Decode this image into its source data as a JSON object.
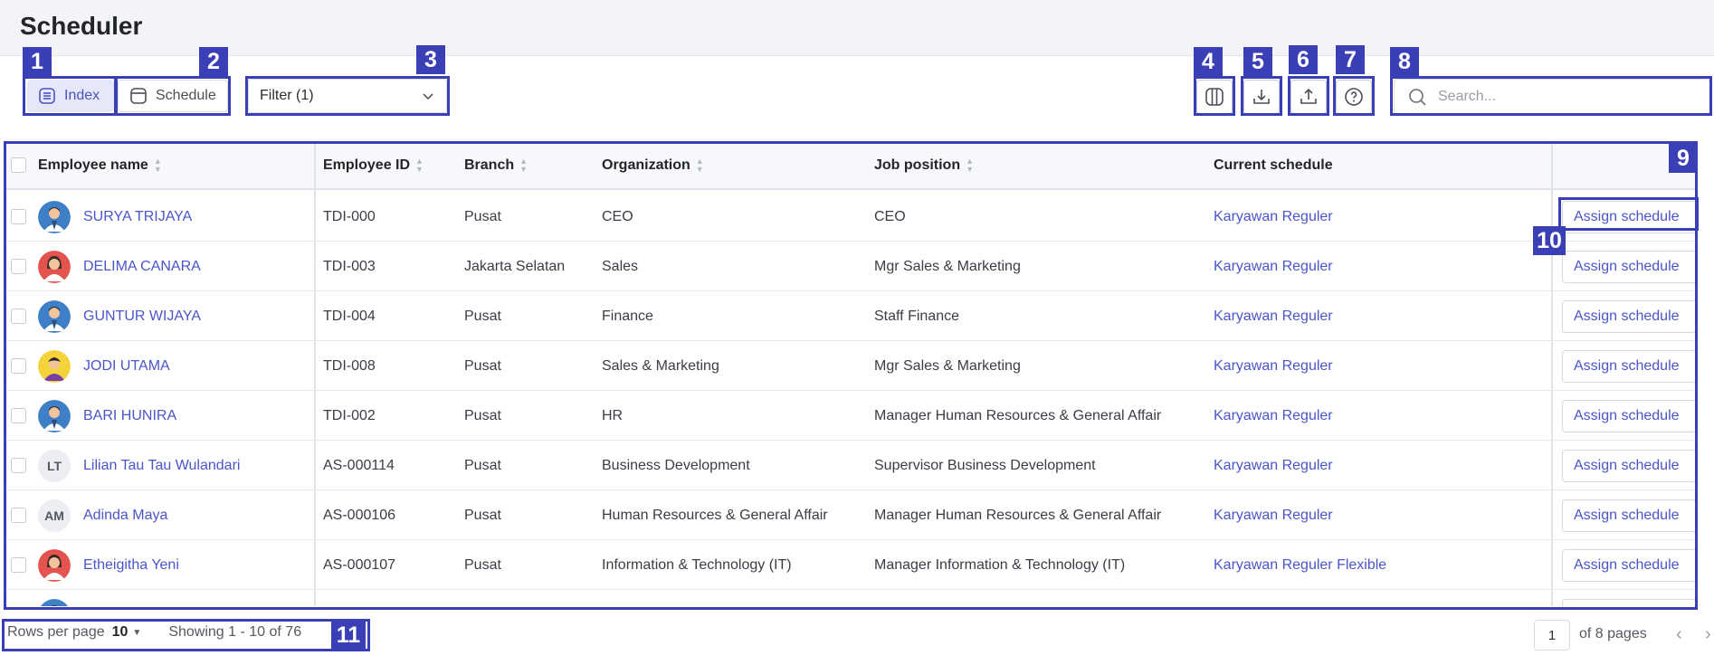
{
  "page": {
    "title": "Scheduler"
  },
  "views": {
    "index_label": "Index",
    "schedule_label": "Schedule"
  },
  "filter": {
    "label": "Filter (1)"
  },
  "toolbar": {
    "columns_icon": "columns-icon",
    "download_icon": "download-icon",
    "export_icon": "export-icon",
    "help_icon": "help-icon"
  },
  "search": {
    "placeholder": "Search..."
  },
  "table": {
    "headers": {
      "employee_name": "Employee name",
      "employee_id": "Employee ID",
      "branch": "Branch",
      "organization": "Organization",
      "job_position": "Job position",
      "current_schedule": "Current schedule"
    },
    "action_label": "Assign schedule",
    "rows": [
      {
        "name": "SURYA TRIJAYA",
        "avatar": "photo-blue",
        "initials": "",
        "id": "TDI-000",
        "branch": "Pusat",
        "organization": "CEO",
        "job": "CEO",
        "schedule": "Karyawan Reguler"
      },
      {
        "name": "DELIMA CANARA",
        "avatar": "photo-red",
        "initials": "",
        "id": "TDI-003",
        "branch": "Jakarta Selatan",
        "organization": "Sales",
        "job": "Mgr Sales & Marketing",
        "schedule": "Karyawan Reguler"
      },
      {
        "name": "GUNTUR WIJAYA",
        "avatar": "photo-blue",
        "initials": "",
        "id": "TDI-004",
        "branch": "Pusat",
        "organization": "Finance",
        "job": "Staff Finance",
        "schedule": "Karyawan Reguler"
      },
      {
        "name": "JODI UTAMA",
        "avatar": "photo-yellow",
        "initials": "",
        "id": "TDI-008",
        "branch": "Pusat",
        "organization": "Sales & Marketing",
        "job": "Mgr Sales & Marketing",
        "schedule": "Karyawan Reguler"
      },
      {
        "name": "BARI HUNIRA",
        "avatar": "photo-blue",
        "initials": "",
        "id": "TDI-002",
        "branch": "Pusat",
        "organization": "HR",
        "job": "Manager Human Resources & General Affair",
        "schedule": "Karyawan Reguler"
      },
      {
        "name": "Lilian Tau Tau Wulandari",
        "avatar": "initials",
        "initials": "LT",
        "id": "AS-000114",
        "branch": "Pusat",
        "organization": "Business Development",
        "job": "Supervisor Business Development",
        "schedule": "Karyawan Reguler"
      },
      {
        "name": "Adinda Maya",
        "avatar": "initials",
        "initials": "AM",
        "id": "AS-000106",
        "branch": "Pusat",
        "organization": "Human Resources & General Affair",
        "job": "Manager Human Resources & General Affair",
        "schedule": "Karyawan Reguler"
      },
      {
        "name": "Etheigitha Yeni",
        "avatar": "photo-red",
        "initials": "",
        "id": "AS-000107",
        "branch": "Pusat",
        "organization": "Information & Technology (IT)",
        "job": "Manager Information & Technology (IT)",
        "schedule": "Karyawan Reguler Flexible"
      }
    ]
  },
  "footer": {
    "rows_per_page_label": "Rows per page",
    "rows_per_page_value": "10",
    "showing": "Showing 1 - 10 of 76",
    "current_page": "1",
    "pages_text": "of 8 pages"
  },
  "annotations": [
    "1",
    "2",
    "3",
    "4",
    "5",
    "6",
    "7",
    "8",
    "9",
    "10",
    "11"
  ],
  "colors": {
    "accent": "#4a55c8",
    "annotation": "#3a3fb5",
    "header_bg": "#f3f4f8"
  }
}
